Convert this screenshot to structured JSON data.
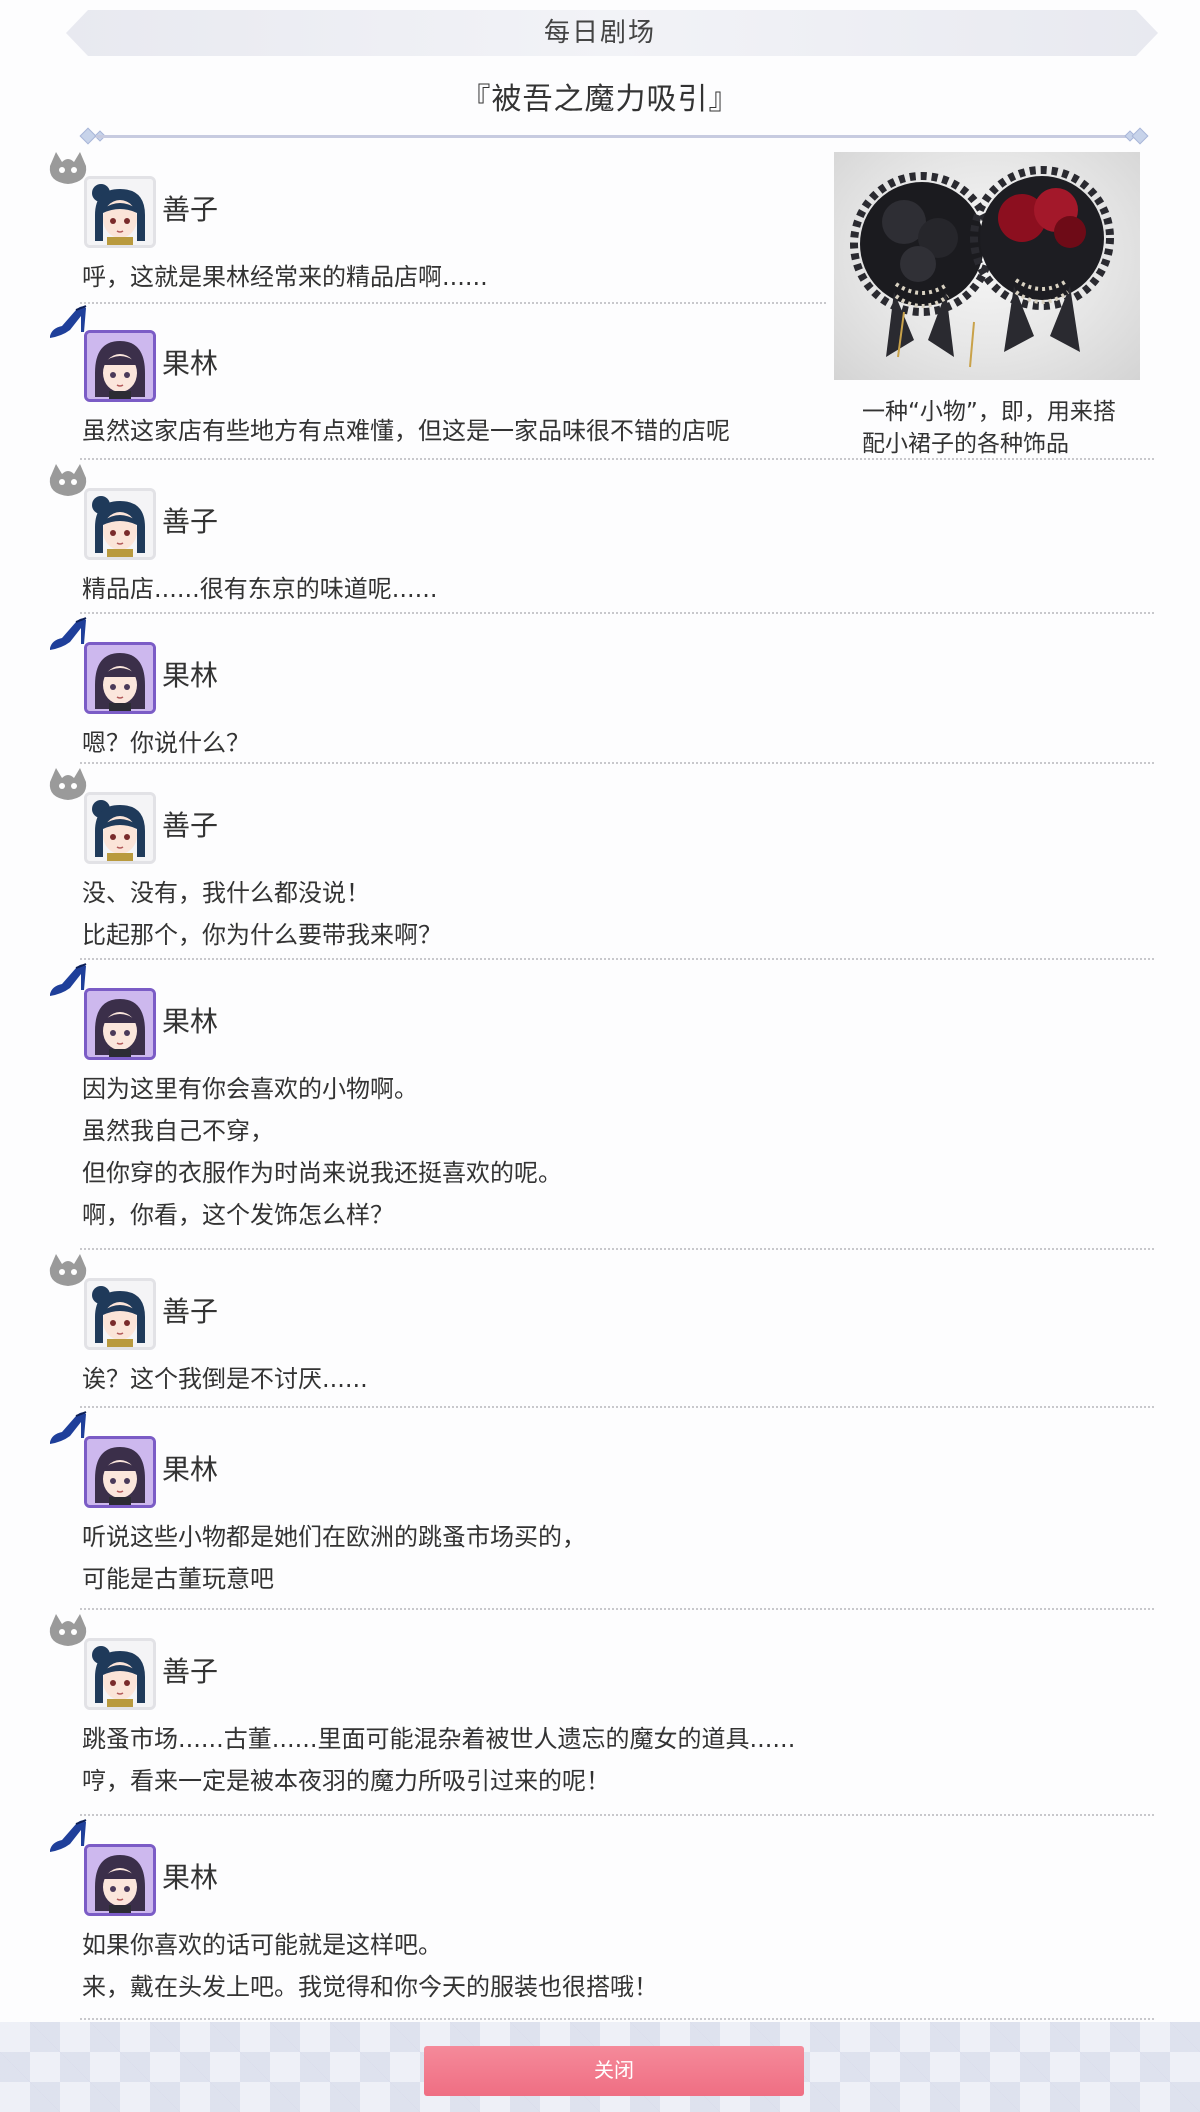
{
  "header": {
    "title": "每日剧场"
  },
  "story": {
    "title": "『被吾之魔力吸引』"
  },
  "side_note": {
    "caption_line1": "一种“小物”，即，用来搭",
    "caption_line2": "配小裙子的各种饰品"
  },
  "characters": {
    "yoshiko": {
      "name": "善子",
      "icon": "bat-mascot-icon"
    },
    "karin": {
      "name": "果林",
      "icon": "high-heel-icon"
    }
  },
  "dialog": [
    {
      "speaker": "善子",
      "lines": [
        "呼，这就是果林经常来的精品店啊......"
      ]
    },
    {
      "speaker": "果林",
      "lines": [
        "虽然这家店有些地方有点难懂，但这是一家品味很不错的店呢"
      ]
    },
    {
      "speaker": "善子",
      "lines": [
        "精品店......很有东京的味道呢......"
      ]
    },
    {
      "speaker": "果林",
      "lines": [
        "嗯？你说什么？"
      ]
    },
    {
      "speaker": "善子",
      "lines": [
        "没、没有，我什么都没说！",
        "比起那个，你为什么要带我来啊？"
      ]
    },
    {
      "speaker": "果林",
      "lines": [
        "因为这里有你会喜欢的小物啊。",
        "虽然我自己不穿，",
        "但你穿的衣服作为时尚来说我还挺喜欢的呢。",
        "啊，你看，这个发饰怎么样？"
      ]
    },
    {
      "speaker": "善子",
      "lines": [
        "诶？这个我倒是不讨厌......"
      ]
    },
    {
      "speaker": "果林",
      "lines": [
        "听说这些小物都是她们在欧洲的跳蚤市场买的，",
        "可能是古董玩意吧"
      ]
    },
    {
      "speaker": "善子",
      "lines": [
        "跳蚤市场......古董......里面可能混杂着被世人遗忘的魔女的道具......",
        "哼，看来一定是被本夜羽的魔力所吸引过来的呢！"
      ]
    },
    {
      "speaker": "果林",
      "lines": [
        "如果你喜欢的话可能就是这样吧。",
        "来，戴在头发上吧。我觉得和你今天的服装也很搭哦！"
      ]
    }
  ],
  "footer": {
    "close_label": "关闭"
  },
  "colors": {
    "accent_button": "#ef6e83",
    "karin_frame": "#7b5cc6",
    "karin_icon": "#1f3f9a",
    "yoshiko_icon": "#9a9a9a"
  }
}
